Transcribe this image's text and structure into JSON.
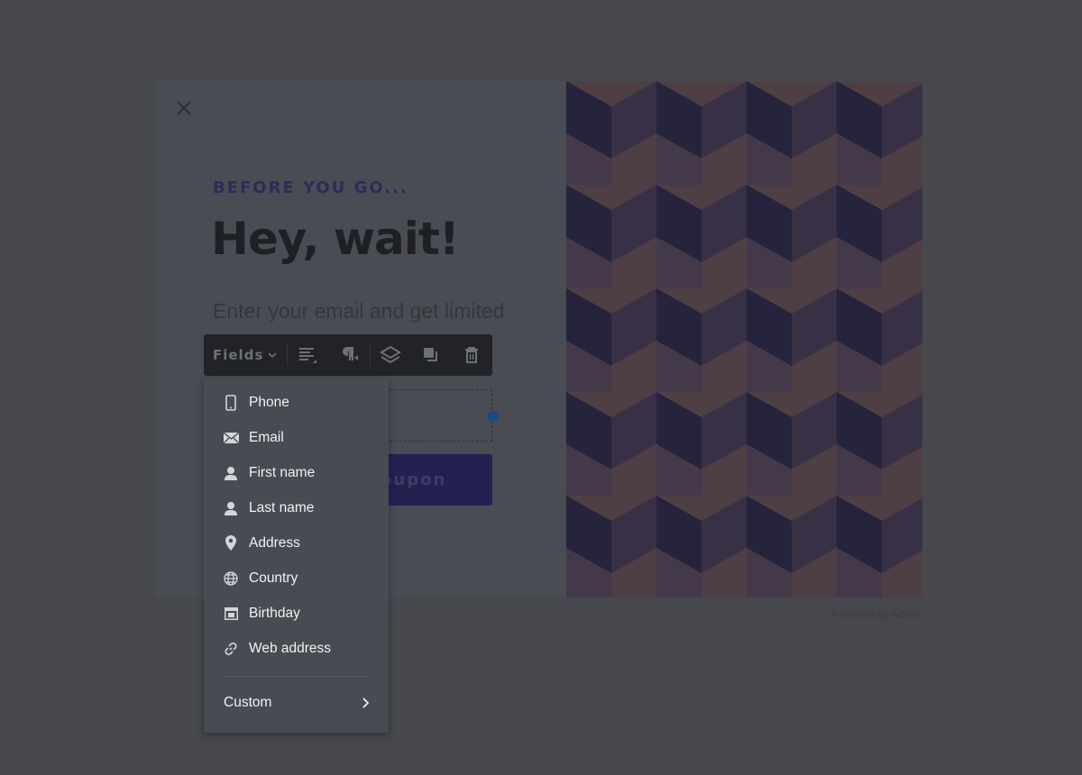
{
  "popup": {
    "eyebrow": "BEFORE YOU GO...",
    "title": "Hey, wait!",
    "body": "Enter your email and get limited",
    "cta_label": "Get my coupon",
    "powered_by": "Powered by Adoric"
  },
  "toolbar": {
    "fields_label": "Fields",
    "buttons": [
      "align-text-icon",
      "paragraph-icon",
      "layers-icon",
      "duplicate-icon",
      "trash-icon"
    ]
  },
  "fields_menu": {
    "items": [
      {
        "label": "Phone",
        "icon": "phone-icon"
      },
      {
        "label": "Email",
        "icon": "envelope-icon"
      },
      {
        "label": "First name",
        "icon": "user-icon"
      },
      {
        "label": "Last name",
        "icon": "user-icon"
      },
      {
        "label": "Address",
        "icon": "map-pin-icon"
      },
      {
        "label": "Country",
        "icon": "globe-icon"
      },
      {
        "label": "Birthday",
        "icon": "calendar-icon"
      },
      {
        "label": "Web address",
        "icon": "link-icon"
      }
    ],
    "custom_label": "Custom"
  },
  "colors": {
    "background": "#46484e",
    "accent": "#23214f",
    "pattern_base": "#4e3f45",
    "pattern_cube": "#1e1e3c",
    "handle": "#1d4a86"
  }
}
